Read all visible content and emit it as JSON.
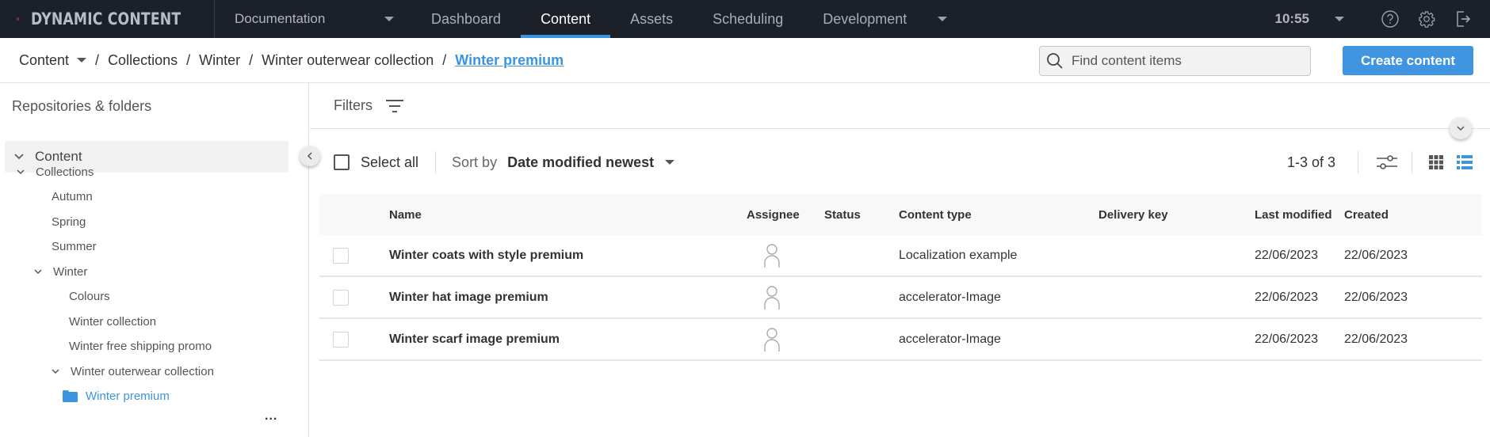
{
  "app": {
    "brand_name": "DYNAMIC CONTENT",
    "hub": "Documentation",
    "nav_tabs": [
      {
        "label": "Dashboard",
        "active": false
      },
      {
        "label": "Content",
        "active": true
      },
      {
        "label": "Assets",
        "active": false
      },
      {
        "label": "Scheduling",
        "active": false
      },
      {
        "label": "Development",
        "active": false
      }
    ],
    "clock": "10:55",
    "icons": {
      "help": "help-circle-icon",
      "settings": "gear-icon",
      "logout": "logout-icon"
    },
    "accent_color": "#3a94e0"
  },
  "breadcrumb": {
    "root": "Content",
    "items": [
      "Collections",
      "Winter",
      "Winter outerwear collection"
    ],
    "current": "Winter premium",
    "separator": "/"
  },
  "search": {
    "placeholder": "Find content items",
    "value": ""
  },
  "create_button": "Create content",
  "sidebar": {
    "title": "Repositories & folders",
    "repository": "Content",
    "tree": [
      {
        "label": "Collections",
        "expanded": true,
        "level": 0
      },
      {
        "label": "Autumn",
        "level": 1
      },
      {
        "label": "Spring",
        "level": 1
      },
      {
        "label": "Summer",
        "level": 1
      },
      {
        "label": "Winter",
        "expanded": true,
        "level": 1
      },
      {
        "label": "Colours",
        "level": 2
      },
      {
        "label": "Winter collection",
        "level": 2
      },
      {
        "label": "Winter free shipping promo",
        "level": 2
      },
      {
        "label": "Winter outerwear collection",
        "expanded": true,
        "level": 2
      },
      {
        "label": "Winter premium",
        "level": 3,
        "selected": true
      }
    ],
    "more_label": "..."
  },
  "filters": {
    "label": "Filters"
  },
  "toolbar": {
    "select_all": "Select all",
    "sort_label": "Sort by",
    "sort_value": "Date modified newest",
    "pager": "1-3 of 3",
    "view_mode": "list"
  },
  "table": {
    "columns": [
      "Name",
      "Assignee",
      "Status",
      "Content type",
      "Delivery key",
      "Last modified",
      "Created"
    ],
    "rows": [
      {
        "name": "Winter coats with style premium",
        "assignee": "",
        "status": "",
        "content_type": "Localization example",
        "delivery_key": "",
        "last_modified": "22/06/2023",
        "created": "22/06/2023"
      },
      {
        "name": "Winter hat image premium",
        "assignee": "",
        "status": "",
        "content_type": "accelerator-Image",
        "delivery_key": "",
        "last_modified": "22/06/2023",
        "created": "22/06/2023"
      },
      {
        "name": "Winter scarf image premium",
        "assignee": "",
        "status": "",
        "content_type": "accelerator-Image",
        "delivery_key": "",
        "last_modified": "22/06/2023",
        "created": "22/06/2023"
      }
    ]
  }
}
